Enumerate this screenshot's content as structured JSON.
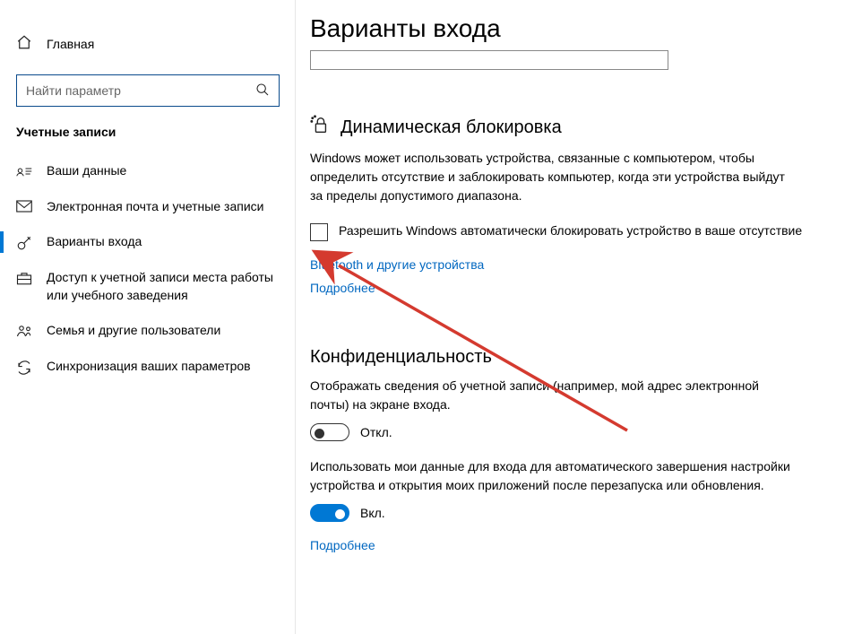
{
  "sidebar": {
    "home_label": "Главная",
    "search_placeholder": "Найти параметр",
    "category": "Учетные записи",
    "items": [
      {
        "label": "Ваши данные"
      },
      {
        "label": "Электронная почта и учетные записи"
      },
      {
        "label": "Варианты входа"
      },
      {
        "label": "Доступ к учетной записи места работы или учебного заведения"
      },
      {
        "label": "Семья и другие пользователи"
      },
      {
        "label": "Синхронизация ваших параметров"
      }
    ]
  },
  "main": {
    "page_title": "Варианты входа",
    "dynamic_lock": {
      "title": "Динамическая блокировка",
      "description": "Windows может использовать устройства, связанные с компьютером, чтобы определить отсутствие и заблокировать компьютер, когда эти устройства выйдут за пределы допустимого диапазона.",
      "checkbox_label": "Разрешить Windows автоматически блокировать устройство в ваше отсутствие",
      "checkbox_checked": false,
      "link_bluetooth": "Bluetooth и другие устройства",
      "link_more": "Подробнее"
    },
    "privacy": {
      "title": "Конфиденциальность",
      "desc1": "Отображать сведения об учетной записи (например, мой адрес электронной почты) на экране входа.",
      "toggle1_state": "off",
      "toggle1_label": "Откл.",
      "desc2": "Использовать мои данные для входа для автоматического завершения настройки устройства и открытия моих приложений после перезапуска или обновления.",
      "toggle2_state": "on",
      "toggle2_label": "Вкл.",
      "link_more": "Подробнее"
    }
  }
}
